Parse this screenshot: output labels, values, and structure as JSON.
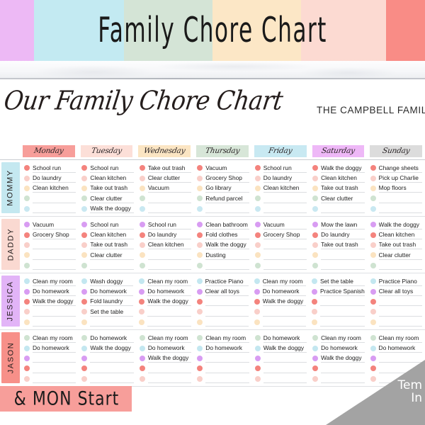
{
  "banner": {
    "title": "Family Chore Chart",
    "stripes": [
      {
        "name": "lavender",
        "color": "#edb9f5",
        "width": 48
      },
      {
        "name": "light-cyan",
        "color": "#c3eaf2",
        "width": 127
      },
      {
        "name": "sage-green",
        "color": "#d4e4d6",
        "width": 125
      },
      {
        "name": "cream-peach",
        "color": "#fce7c6",
        "width": 125
      },
      {
        "name": "light-pink",
        "color": "#fcdad2",
        "width": 120
      },
      {
        "name": "coral",
        "color": "#f98c86",
        "width": 55
      }
    ]
  },
  "sheet": {
    "script_title": "Our Family Chore Chart",
    "family_name": "THE CAMPBELL FAMIL"
  },
  "days": [
    {
      "label": "Monday",
      "bg": "#f79e9a"
    },
    {
      "label": "Tuesday",
      "bg": "#fcdfd8"
    },
    {
      "label": "Wednesday",
      "bg": "#fbe5c3"
    },
    {
      "label": "Thursday",
      "bg": "#d7e6d8"
    },
    {
      "label": "Friday",
      "bg": "#c8e9f2"
    },
    {
      "label": "Saturday",
      "bg": "#eeb8f7"
    },
    {
      "label": "Sunday",
      "bg": "#dcdcdc"
    }
  ],
  "people": [
    {
      "name": "MOMMY",
      "tab_bg": "#c4e8f0",
      "dot_colors": [
        "#f4837d",
        "#f9cfc9",
        "#fbe3c0",
        "#cfe3d1",
        "#c9e8f1"
      ],
      "columns": [
        [
          "School run",
          "Do laundry",
          "Clean kitchen",
          "",
          ""
        ],
        [
          "School run",
          "Clean kitchen",
          "Take out trash",
          "Clear clutter",
          "Walk the doggy"
        ],
        [
          "Take out trash",
          "Clear clutter",
          "Vacuum",
          "",
          ""
        ],
        [
          "Vacuum",
          "Grocery Shop",
          "Go library",
          "Refund parcel",
          ""
        ],
        [
          "School run",
          "Do laundry",
          "Clean kitchen",
          "",
          ""
        ],
        [
          "Walk the doggy",
          "Clean kitchen",
          "Take out trash",
          "Clear clutter",
          ""
        ],
        [
          "Change sheets",
          "Pick up Charlie",
          "Mop floors",
          "",
          ""
        ]
      ]
    },
    {
      "name": "DADDY",
      "tab_bg": "#fad9d1",
      "dot_colors": [
        "#d89cf2",
        "#f4837d",
        "#f9cfc9",
        "#fbe3c0",
        "#cfe3d1"
      ],
      "columns": [
        [
          "Vacuum",
          "Grocery Shop",
          "",
          "",
          ""
        ],
        [
          "School run",
          "Clean kitchen",
          "Take out trash",
          "Clear clutter",
          ""
        ],
        [
          "School run",
          "Do laundry",
          "Clean kitchen",
          "",
          ""
        ],
        [
          "Clean bathroom",
          "Fold clothes",
          "Walk the doggy",
          "Dusting",
          ""
        ],
        [
          "Vacuum",
          "Grocery Shop",
          "",
          "",
          ""
        ],
        [
          "Mow the lawn",
          "Do laundry",
          "Take out trash",
          "",
          ""
        ],
        [
          "Walk the doggy",
          "Clean kitchen",
          "Take out trash",
          "Clear clutter",
          ""
        ]
      ]
    },
    {
      "name": "JESSICA",
      "tab_bg": "#e2b4f7",
      "dot_colors": [
        "#c3e7f0",
        "#d89cf2",
        "#f4837d",
        "#f9cfc9",
        "#fbe3c0"
      ],
      "columns": [
        [
          "Clean my room",
          "Do homework",
          "Walk the doggy",
          "",
          ""
        ],
        [
          "Wash doggy",
          "Do homework",
          "Fold laundry",
          "Set the table",
          ""
        ],
        [
          "Clean my room",
          "Do homework",
          "Walk the doggy",
          "",
          ""
        ],
        [
          "Practice Piano",
          "Clear all toys",
          "",
          "",
          ""
        ],
        [
          "Clean my room",
          "Do homework",
          "Walk the doggy",
          "",
          ""
        ],
        [
          "Set the table",
          "Practice Spanish",
          "",
          "",
          ""
        ],
        [
          "Practice Piano",
          "Clear all toys",
          "",
          "",
          ""
        ]
      ]
    },
    {
      "name": "JASON",
      "tab_bg": "#f79089",
      "dot_colors": [
        "#cfe3d1",
        "#c3e7f0",
        "#d89cf2",
        "#f4837d",
        "#f9cfc9"
      ],
      "columns": [
        [
          "Clean my room",
          "Do homework",
          "",
          "",
          ""
        ],
        [
          "Do homework",
          "Walk the doggy",
          "",
          "",
          ""
        ],
        [
          "Clean my room",
          "Do homework",
          "Walk the doggy",
          "",
          ""
        ],
        [
          "Clean my room",
          "Do homework",
          "",
          "",
          ""
        ],
        [
          "Do homework",
          "Walk the doggy",
          "",
          "",
          ""
        ],
        [
          "Clean my room",
          "Do homework",
          "Walk the doggy",
          "",
          ""
        ],
        [
          "Clean my room",
          "Do homework",
          "",
          "",
          ""
        ]
      ]
    }
  ],
  "overlays": {
    "start_banner": "& MON Start",
    "corner_line1": "Tem",
    "corner_line2": "In"
  }
}
